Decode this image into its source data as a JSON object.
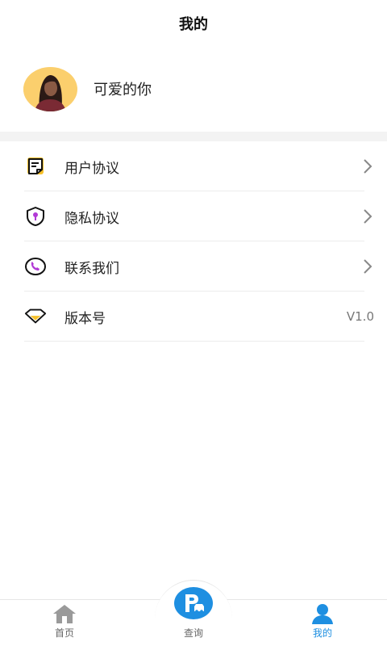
{
  "header": {
    "title": "我的"
  },
  "profile": {
    "name": "可爱的你",
    "avatar_icon": "avatar-woman"
  },
  "menu": {
    "items": [
      {
        "label": "用户协议",
        "icon": "document-icon",
        "trailing": "chevron"
      },
      {
        "label": "隐私协议",
        "icon": "shield-lock-icon",
        "trailing": "chevron"
      },
      {
        "label": "联系我们",
        "icon": "phone-icon",
        "trailing": "chevron"
      },
      {
        "label": "版本号",
        "icon": "diamond-icon",
        "trailing": "V1.0"
      }
    ]
  },
  "tabbar": {
    "items": [
      {
        "label": "首页",
        "icon": "home-icon"
      },
      {
        "label": "查询",
        "icon": "parking-icon"
      },
      {
        "label": "我的",
        "icon": "user-icon",
        "active": true
      }
    ]
  },
  "colors": {
    "accent": "#1e8fe1",
    "avatar_bg": "#fbcf6d",
    "icon_yellow": "#f6c02a",
    "icon_purple": "#b23ad6"
  }
}
